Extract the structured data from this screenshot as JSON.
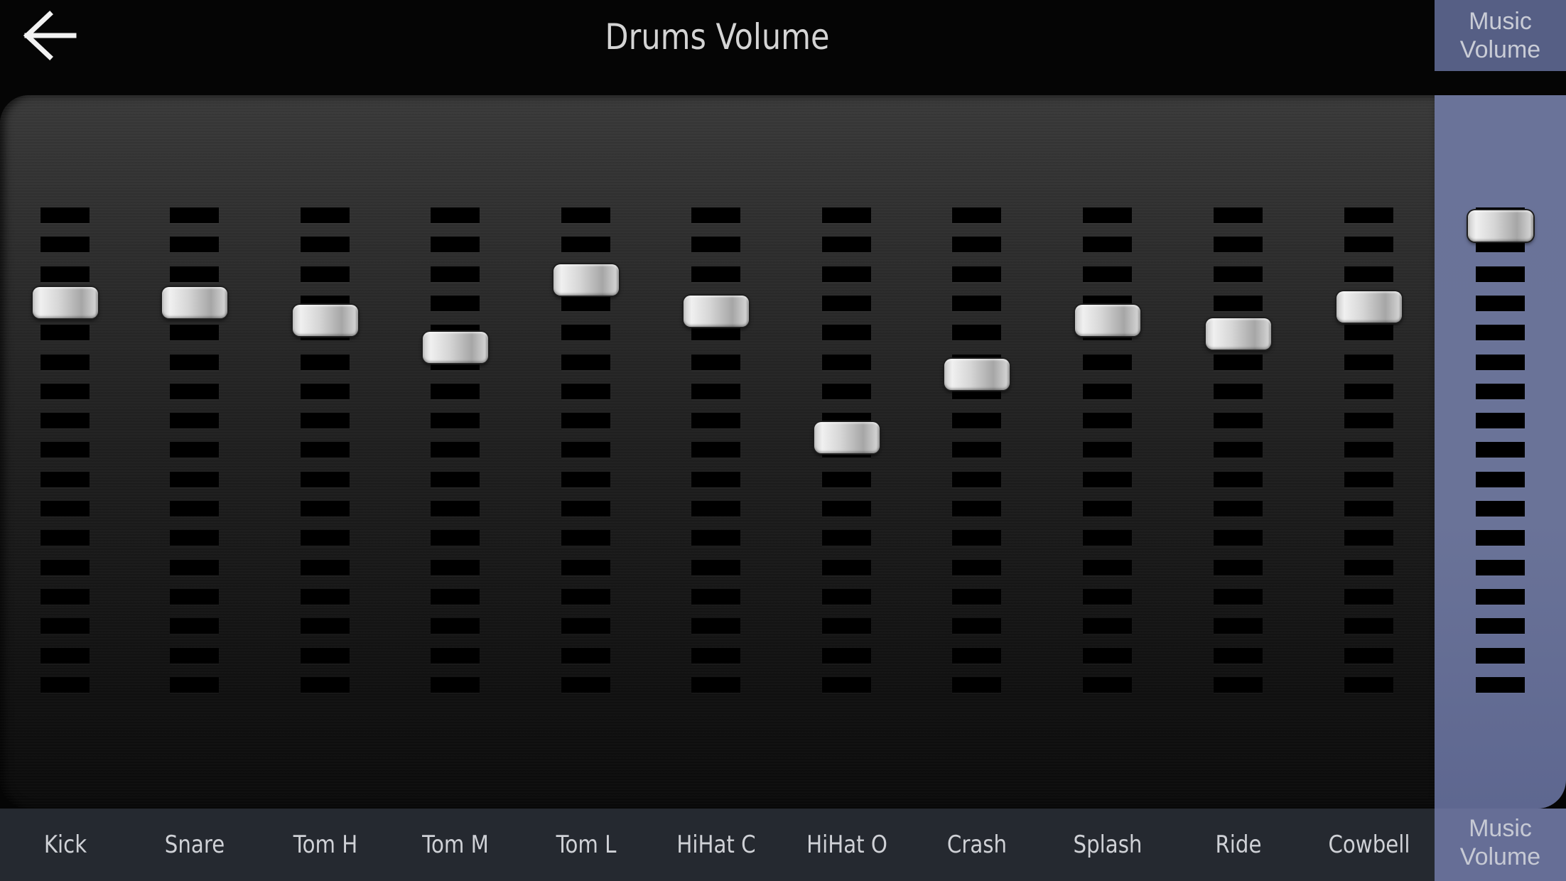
{
  "header": {
    "title": "Drums Volume",
    "back_icon": "arrow-left-icon"
  },
  "music_button": {
    "line1": "Music",
    "line2": "Volume"
  },
  "channels": [
    {
      "label": "Kick",
      "volume_percent": 83
    },
    {
      "label": "Snare",
      "volume_percent": 83
    },
    {
      "label": "Tom H",
      "volume_percent": 79
    },
    {
      "label": "Tom M",
      "volume_percent": 73
    },
    {
      "label": "Tom L",
      "volume_percent": 88
    },
    {
      "label": "HiHat C",
      "volume_percent": 81
    },
    {
      "label": "HiHat O",
      "volume_percent": 53
    },
    {
      "label": "Crash",
      "volume_percent": 67
    },
    {
      "label": "Splash",
      "volume_percent": 79
    },
    {
      "label": "Ride",
      "volume_percent": 76
    },
    {
      "label": "Cowbell",
      "volume_percent": 82
    }
  ],
  "music_channel": {
    "line1": "Music",
    "line2": "Volume",
    "volume_percent": 100
  },
  "colors": {
    "background": "#050505",
    "music_panel": "#6a7399",
    "footer": "#252930",
    "text": "#cfd1d6"
  }
}
